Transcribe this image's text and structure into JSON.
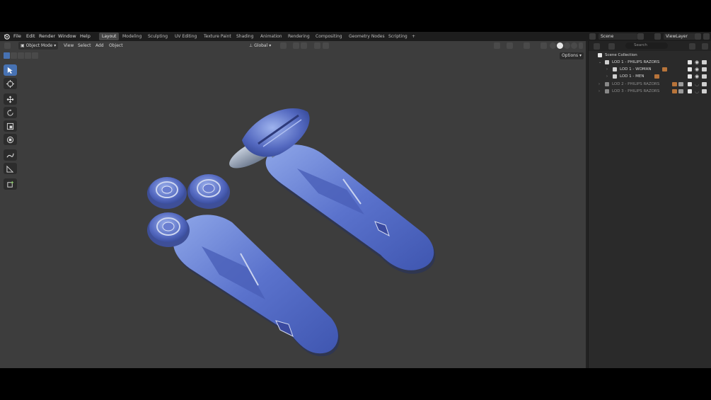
{
  "topbar": {
    "menu": [
      "File",
      "Edit",
      "Render",
      "Window",
      "Help"
    ],
    "workspaces": [
      "Layout",
      "Modeling",
      "Sculpting",
      "UV Editing",
      "Texture Paint",
      "Shading",
      "Animation",
      "Rendering",
      "Compositing",
      "Geometry Nodes",
      "Scripting"
    ],
    "add_tab": "+",
    "scene": "Scene",
    "view_layer": "ViewLayer"
  },
  "viewport": {
    "mode": "Object Mode",
    "menu": [
      "View",
      "Select",
      "Add",
      "Object"
    ],
    "orientation": "Global",
    "options": "Options",
    "background_color": "#3d3d3d",
    "model_color": "#5b73c9"
  },
  "toolbar": {
    "tools": [
      "select-box-icon",
      "cursor-icon",
      "move-icon",
      "rotate-icon",
      "scale-icon",
      "transform-icon",
      "annotate-icon",
      "measure-icon",
      "add-cube-icon"
    ]
  },
  "outliner": {
    "search_placeholder": "Search",
    "scene_collection": "Scene Collection",
    "items": [
      {
        "label": "LOD 1 - PHILIPS RAZORS"
      },
      {
        "label": "LOD 1 - WOMAN"
      },
      {
        "label": "LOD 1 - MEN"
      },
      {
        "label": "LOD 2 - PHILIPS RAZORS"
      },
      {
        "label": "LOD 3 - PHILIPS RAZORS"
      }
    ]
  }
}
